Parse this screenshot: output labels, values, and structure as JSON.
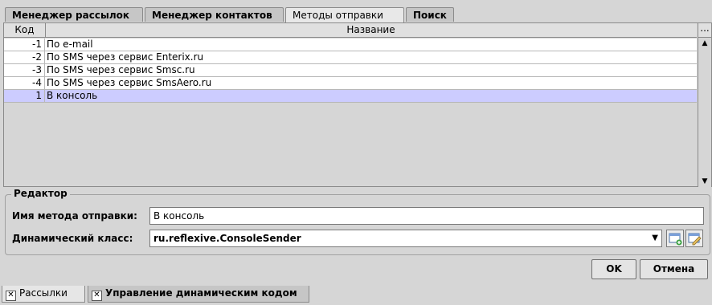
{
  "tabs": [
    {
      "label": "Менеджер рассылок"
    },
    {
      "label": "Менеджер контактов"
    },
    {
      "label": "Методы отправки"
    },
    {
      "label": "Поиск"
    }
  ],
  "table": {
    "columns": [
      "Код",
      "Название"
    ],
    "corner": "...",
    "rows": [
      {
        "code": "-1",
        "name": "По e-mail"
      },
      {
        "code": "-2",
        "name": "По SMS через сервис Enterix.ru"
      },
      {
        "code": "-3",
        "name": "По SMS через сервис Smsc.ru"
      },
      {
        "code": "-4",
        "name": "По SMS через сервис SmsAero.ru"
      },
      {
        "code": "1",
        "name": "В консоль"
      }
    ],
    "selected_row": 4
  },
  "editor": {
    "title": "Редактор",
    "method_label": "Имя метода отправки:",
    "method_value": "В консоль",
    "class_label": "Динамический класс:",
    "class_value": "ru.reflexive.ConsoleSender"
  },
  "buttons": {
    "ok": "OK",
    "cancel": "Отмена"
  },
  "bottom_tabs": [
    {
      "label": "Рассылки"
    },
    {
      "label": "Управление динамическим кодом"
    }
  ]
}
